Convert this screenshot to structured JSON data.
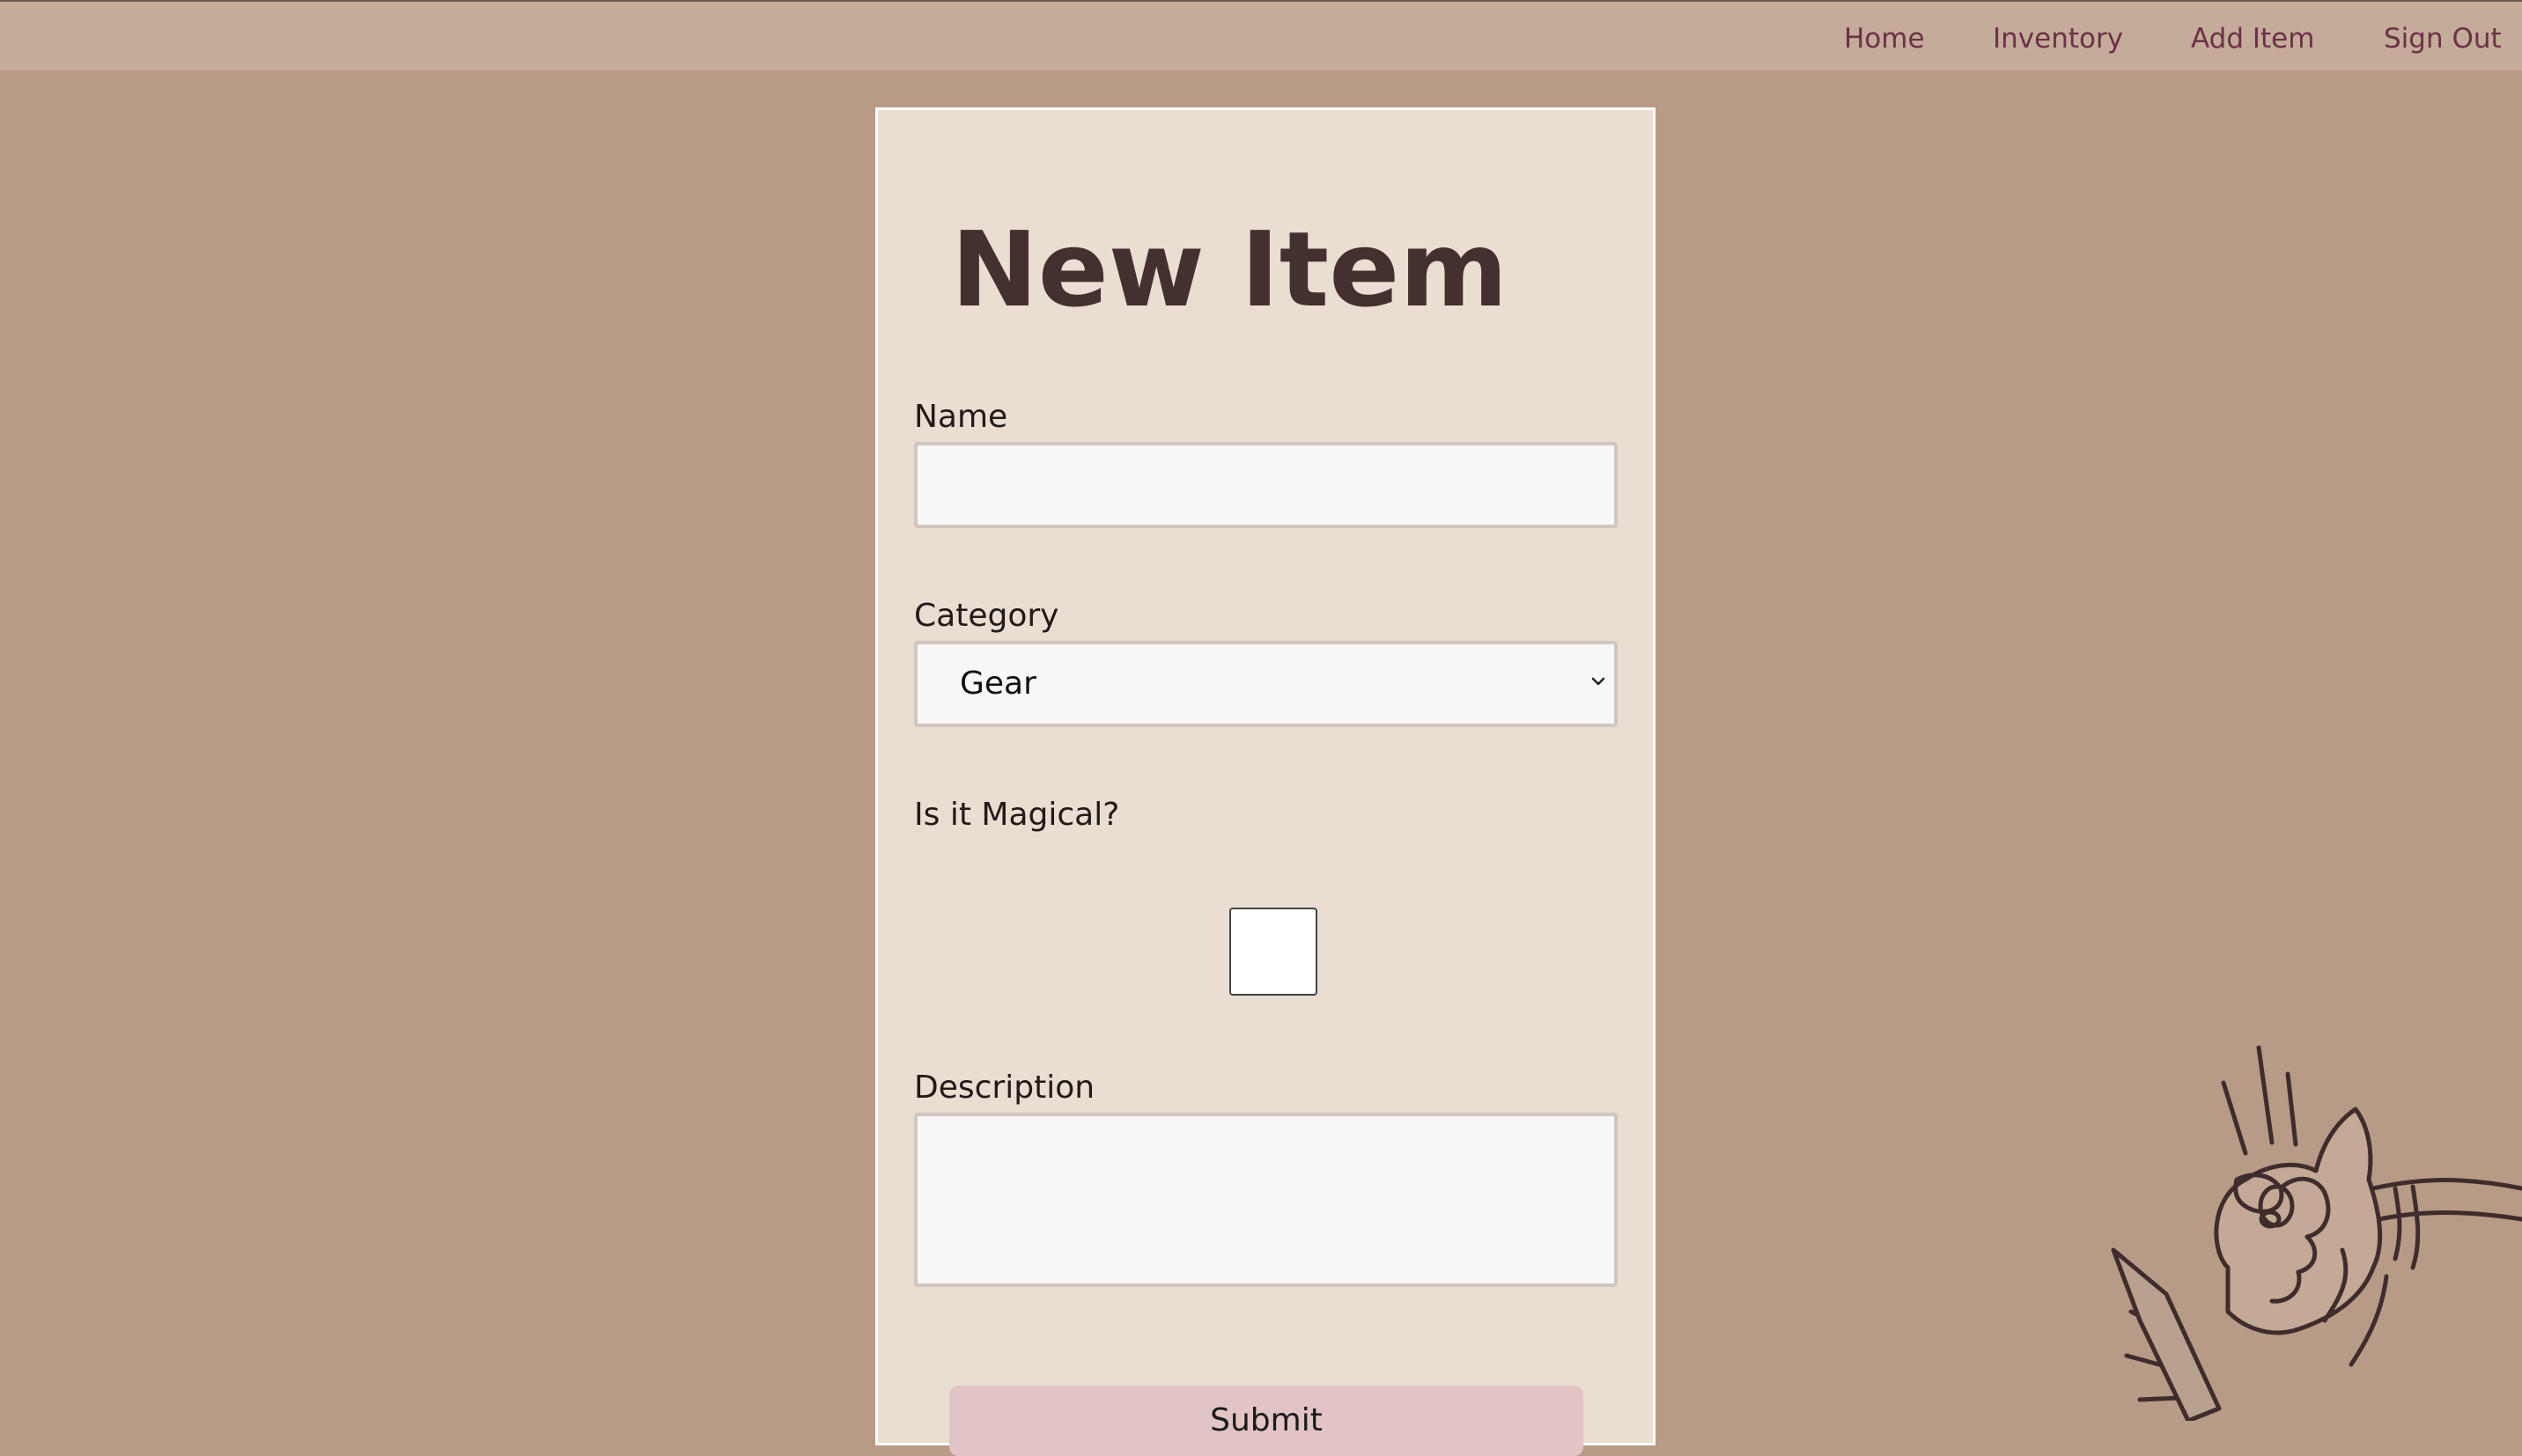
{
  "nav": {
    "links": [
      "Home",
      "Inventory",
      "Add Item",
      "Sign Out"
    ]
  },
  "form": {
    "title": "New Item",
    "name_label": "Name",
    "name_value": "",
    "category_label": "Category",
    "category_value": "Gear",
    "magical_label": "Is it Magical?",
    "magical_checked": false,
    "description_label": "Description",
    "description_value": "",
    "submit_label": "Submit"
  },
  "decor": {
    "mascot": "hand-with-sword-illustration"
  },
  "colors": {
    "background": "#b89b86",
    "navbar": "#c5ab99",
    "nav_link": "#6b3146",
    "card": "#eaddd1",
    "title": "#44302f",
    "submit": "#e1c4c3"
  }
}
